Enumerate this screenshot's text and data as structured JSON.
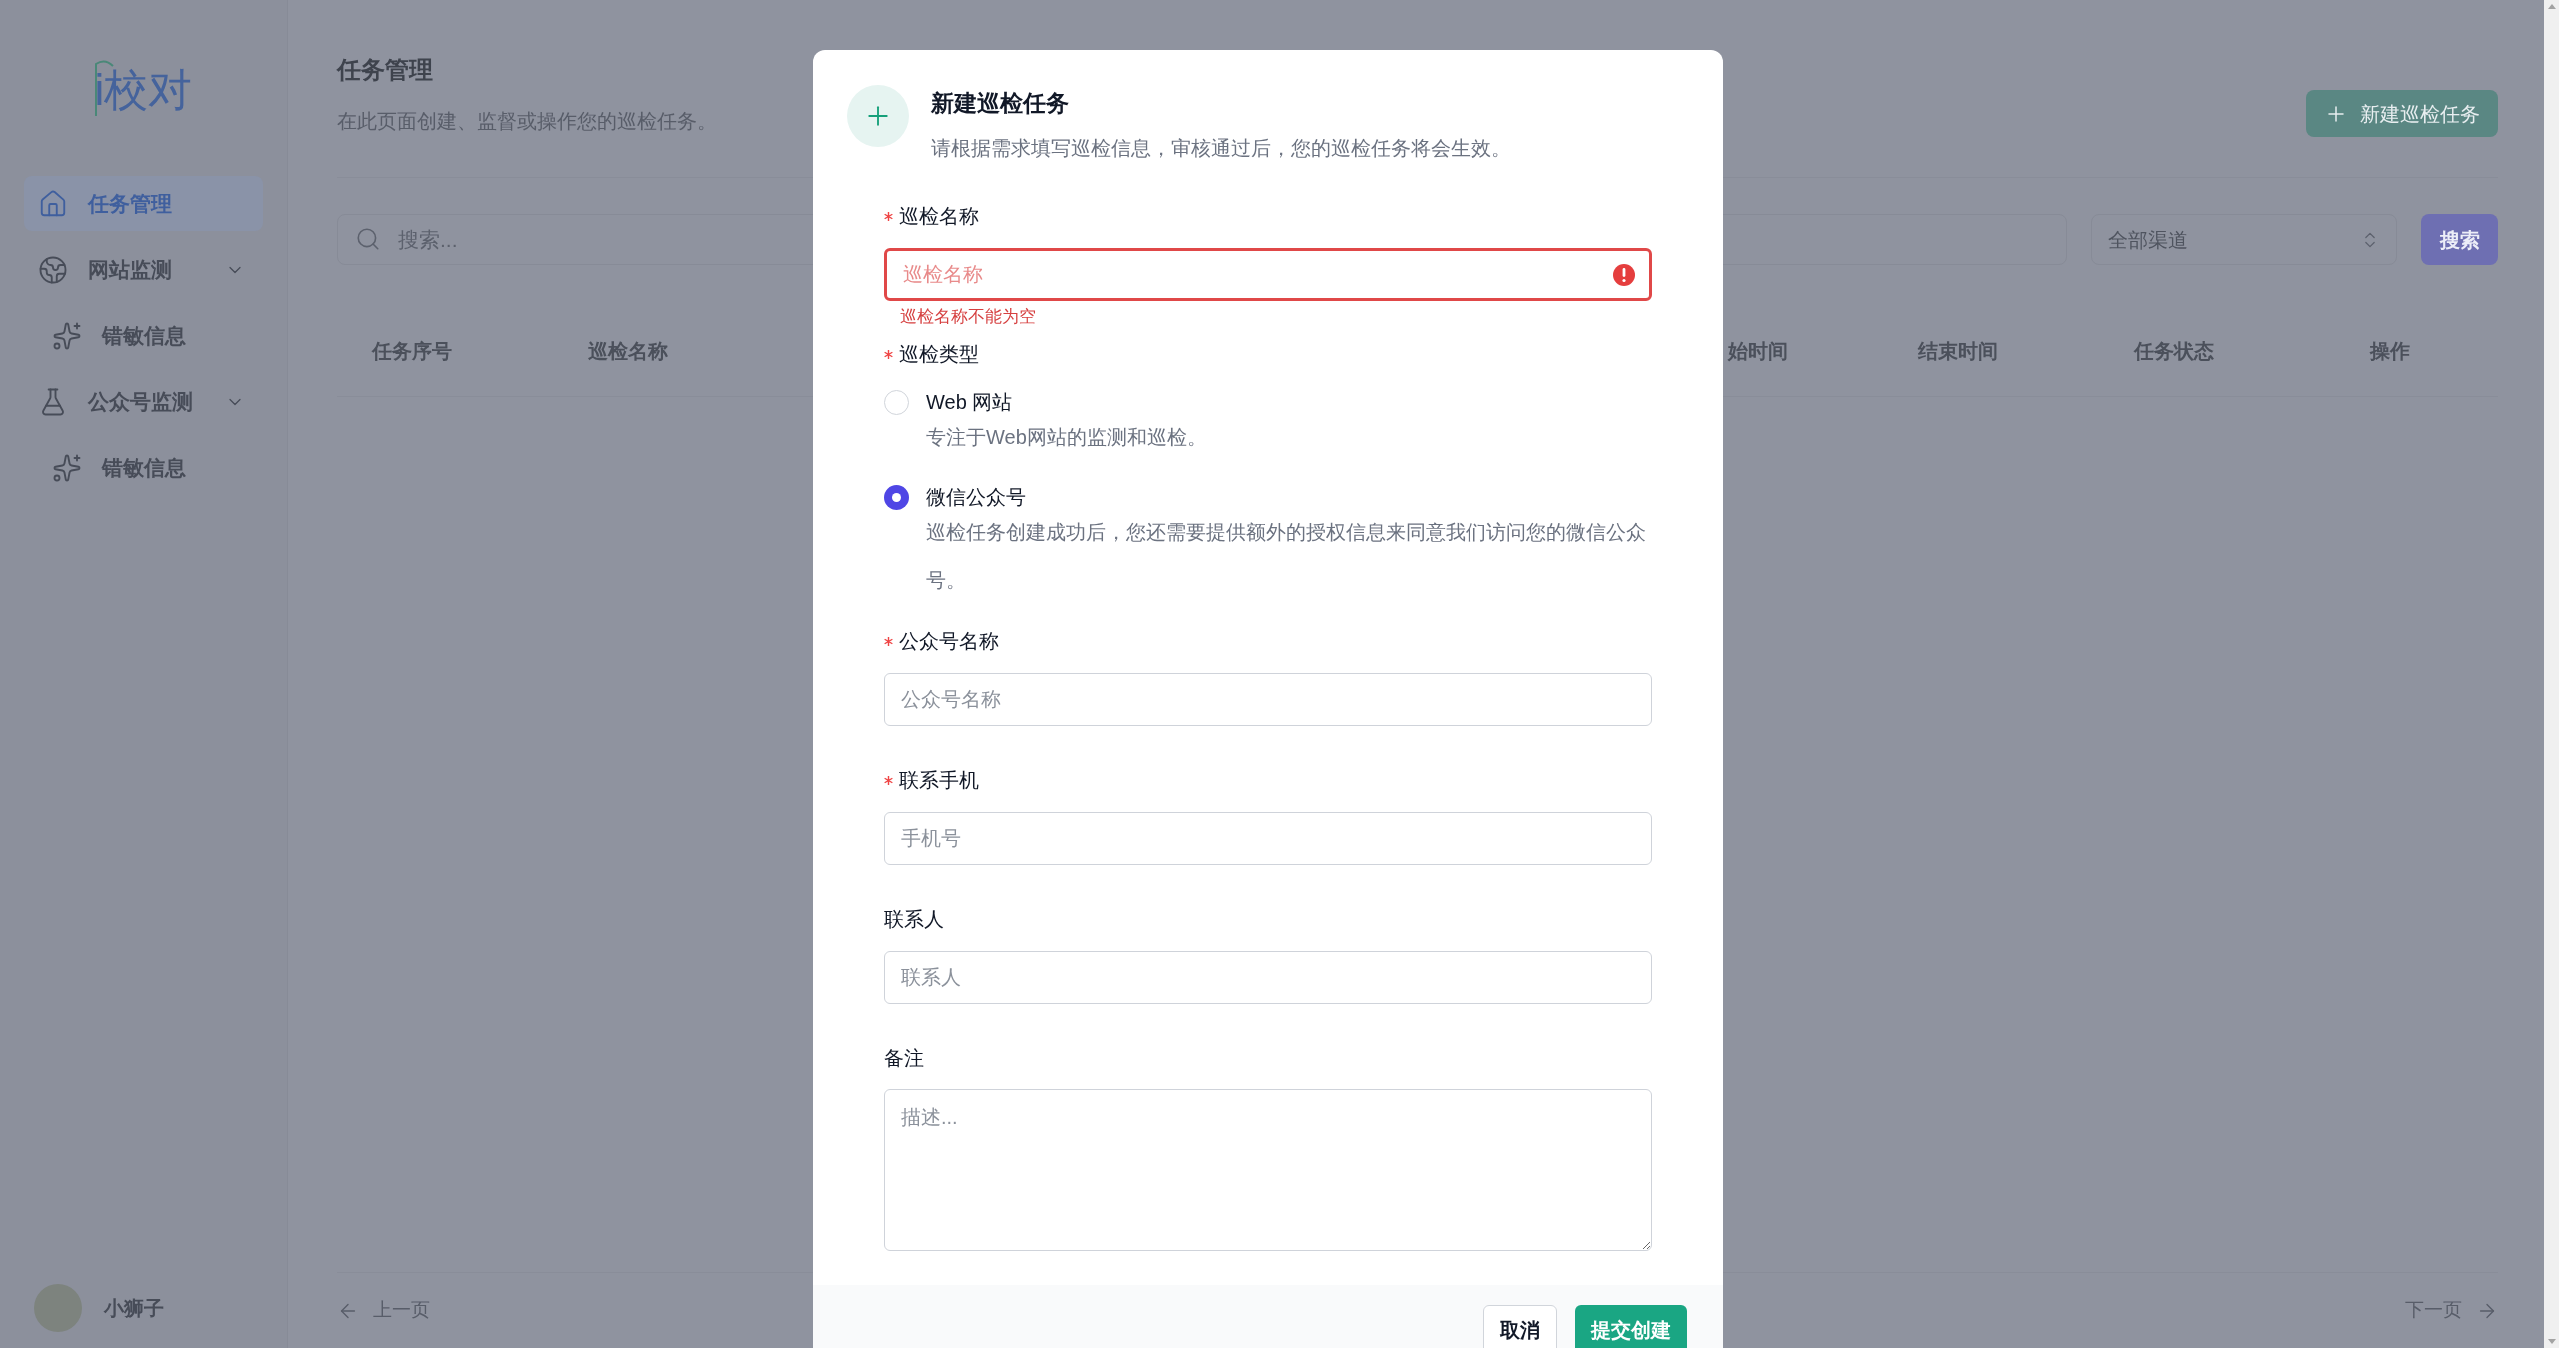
{
  "sidebar": {
    "logo": "i校对",
    "items": [
      {
        "label": "任务管理",
        "selected": true
      },
      {
        "label": "网站监测",
        "selected": false,
        "expanded": true,
        "children": [
          {
            "label": "错敏信息",
            "selected": false
          }
        ]
      },
      {
        "label": "公众号监测",
        "selected": false,
        "expanded": true,
        "children": [
          {
            "label": "错敏信息",
            "selected": false
          }
        ]
      }
    ],
    "user": {
      "name": "小狮子"
    }
  },
  "main": {
    "title": "任务管理",
    "subtitle": "在此页面创建、监督或操作您的巡检任务。",
    "new_button": "新建巡检任务",
    "search": {
      "placeholder": "搜索..."
    },
    "channel_select": {
      "value": "全部渠道"
    },
    "search_button": "搜索",
    "table": {
      "columns": [
        {
          "label": "任务序号",
          "kind": "left"
        },
        {
          "label": "巡检名称",
          "kind": "left"
        },
        {
          "label": "始时间",
          "kind": "cut"
        },
        {
          "label": "结束时间",
          "kind": "right"
        },
        {
          "label": "任务状态",
          "kind": "right"
        },
        {
          "label": "操作",
          "kind": "right"
        }
      ]
    },
    "pagination": {
      "prev": "上一页",
      "next": "下一页"
    }
  },
  "dialog": {
    "title": "新建巡检任务",
    "subtitle": "请根据需求填写巡检信息，审核通过后，您的巡检任务将会生效。",
    "fields": [
      {
        "kind": "text",
        "label": "巡检名称",
        "required": true,
        "placeholder": "巡检名称",
        "error": "巡检名称不能为空"
      },
      {
        "kind": "radio",
        "label": "巡检类型",
        "required": true,
        "options": [
          {
            "label": "Web 网站",
            "description": "专注于Web网站的监测和巡检。",
            "selected": false
          },
          {
            "label": "微信公众号",
            "description": "巡检任务创建成功后，您还需要提供额外的授权信息来同意我们访问您的微信公众号。",
            "selected": true
          }
        ]
      },
      {
        "kind": "text",
        "label": "公众号名称",
        "required": true,
        "placeholder": "公众号名称"
      },
      {
        "kind": "text",
        "label": "联系手机",
        "required": true,
        "placeholder": "手机号"
      },
      {
        "kind": "text",
        "label": "联系人",
        "required": false,
        "placeholder": "联系人"
      },
      {
        "kind": "textarea",
        "label": "备注",
        "required": false,
        "placeholder": "描述..."
      }
    ],
    "cancel": "取消",
    "submit": "提交创建"
  }
}
